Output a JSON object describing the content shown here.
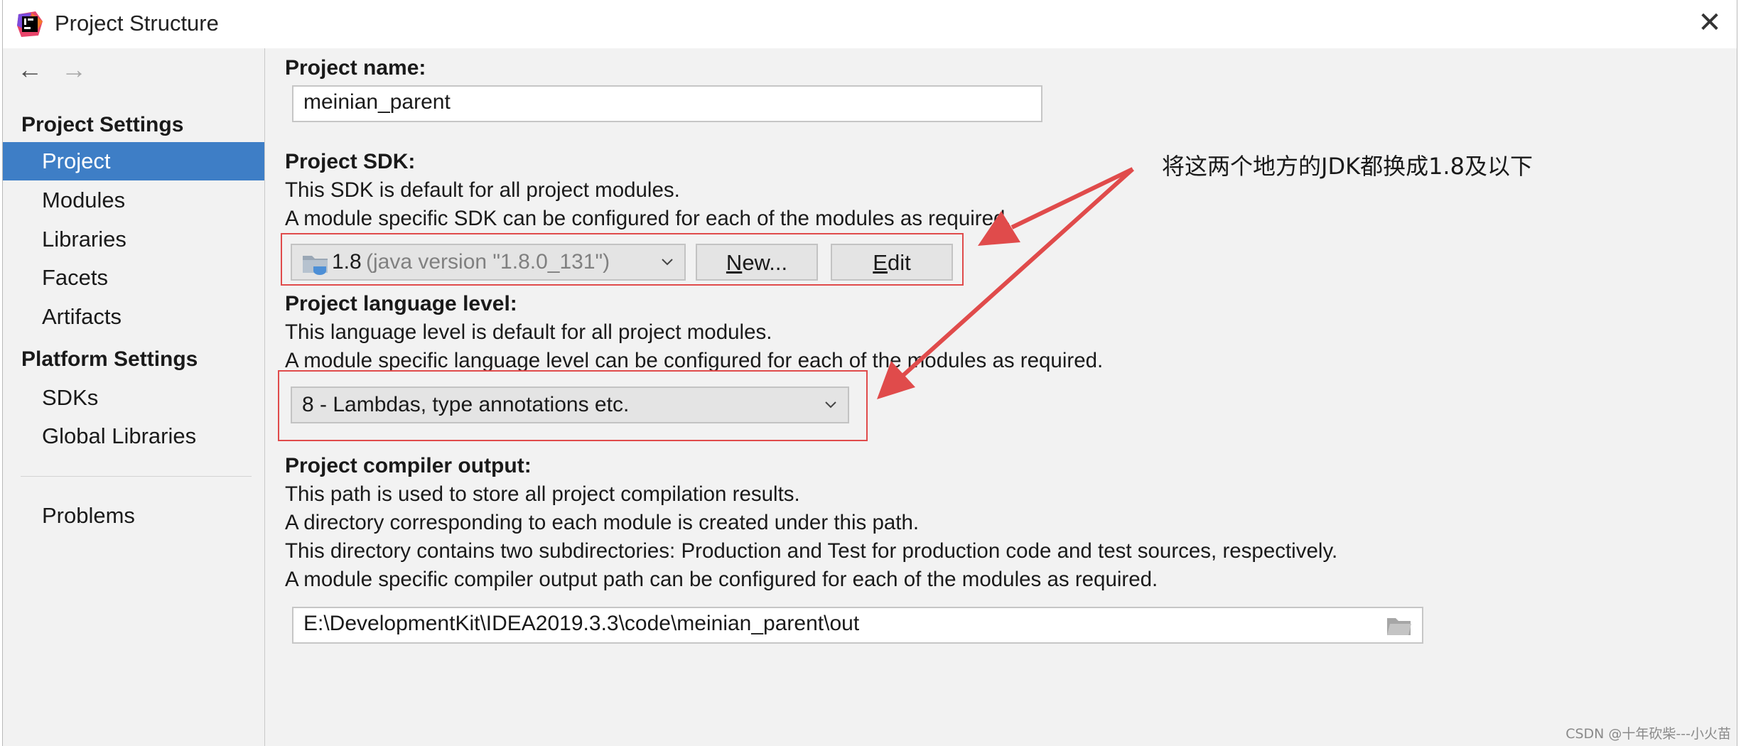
{
  "window": {
    "title": "Project Structure",
    "close_symbol": "✕"
  },
  "sidebar": {
    "back_symbol": "←",
    "forward_symbol": "→",
    "project_settings_header": "Project Settings",
    "project_settings_items": [
      {
        "label": "Project",
        "selected": true
      },
      {
        "label": "Modules"
      },
      {
        "label": "Libraries"
      },
      {
        "label": "Facets"
      },
      {
        "label": "Artifacts"
      }
    ],
    "platform_settings_header": "Platform Settings",
    "platform_settings_items": [
      {
        "label": "SDKs"
      },
      {
        "label": "Global Libraries"
      }
    ],
    "problems_label": "Problems"
  },
  "project": {
    "name_label": "Project name:",
    "name_value": "meinian_parent",
    "sdk_label": "Project SDK:",
    "sdk_desc1": "This SDK is default for all project modules.",
    "sdk_desc2": "A module specific SDK can be configured for each of the modules as required.",
    "sdk_value": "1.8",
    "sdk_version": "(java version \"1.8.0_131\")",
    "sdk_new_first": "N",
    "sdk_new_rest": "ew...",
    "sdk_edit_first": "E",
    "sdk_edit_rest": "dit",
    "lang_label": "Project language level:",
    "lang_desc1": "This language level is default for all project modules.",
    "lang_desc2": "A module specific language level can be configured for each of the modules as required.",
    "lang_value": "8 - Lambdas, type annotations etc.",
    "output_label": "Project compiler output:",
    "output_desc1": "This path is used to store all project compilation results.",
    "output_desc2": "A directory corresponding to each module is created under this path.",
    "output_desc3": "This directory contains two subdirectories: Production and Test for production code and test sources, respectively.",
    "output_desc4": "A module specific compiler output path can be configured for each of the modules as required.",
    "output_path": "E:\\DevelopmentKit\\IDEA2019.3.3\\code\\meinian_parent\\out"
  },
  "annotation": {
    "text": "将这两个地方的JDK都换成1.8及以下",
    "color": "#e04b4b"
  },
  "watermark": "CSDN @十年砍柴---小火苗"
}
